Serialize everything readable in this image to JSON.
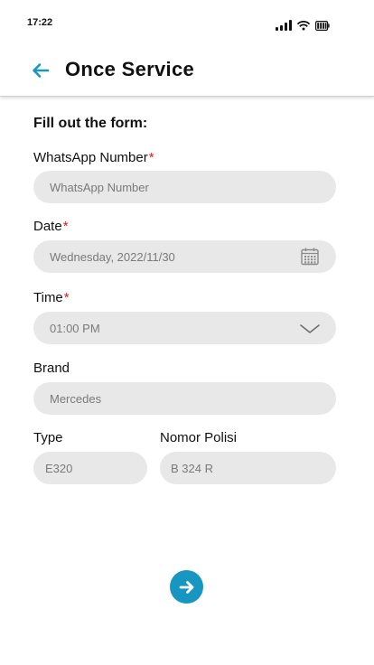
{
  "status_bar": {
    "time": "17:22"
  },
  "header": {
    "title": "Once Service"
  },
  "form": {
    "heading": "Fill out the form:",
    "whatsapp": {
      "label": "WhatsApp Number",
      "required_mark": "*",
      "placeholder": "WhatsApp Number"
    },
    "date": {
      "label": "Date",
      "required_mark": "*",
      "value": "Wednesday, 2022/11/30"
    },
    "time": {
      "label": "Time",
      "required_mark": "*",
      "value": "01:00 PM"
    },
    "brand": {
      "label": "Brand",
      "value": "Mercedes"
    },
    "type": {
      "label": "Type",
      "value": "E320"
    },
    "nomor_polisi": {
      "label": "Nomor Polisi",
      "value": "B 324 R"
    }
  },
  "colors": {
    "accent": "#1796c0",
    "required": "#e01818",
    "field_bg": "#e8e8e8"
  },
  "icons": {
    "back": "arrow-left-icon",
    "calendar": "calendar-icon",
    "dropdown": "chevron-down-icon",
    "next": "arrow-right-icon"
  }
}
